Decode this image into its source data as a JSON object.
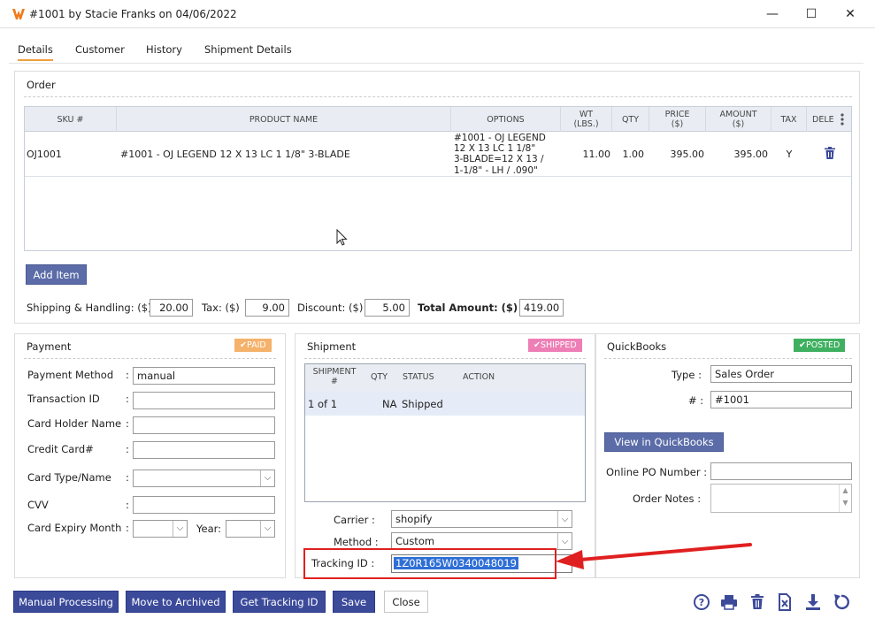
{
  "window": {
    "title": "#1001 by Stacie Franks on 04/06/2022",
    "minimize_glyph": "—",
    "maximize_glyph": "☐",
    "close_glyph": "✕"
  },
  "tabs": [
    "Details",
    "Customer",
    "History",
    "Shipment Details"
  ],
  "order": {
    "section_title": "Order",
    "columns": {
      "sku": "SKU #",
      "product": "PRODUCT NAME",
      "options": "OPTIONS",
      "wt": "WT (LBS.)",
      "qty": "QTY",
      "price": "PRICE ($)",
      "amount": "AMOUNT ($)",
      "tax": "TAX",
      "delete": "DELE"
    },
    "row": {
      "sku": "OJ1001",
      "product": "#1001 - OJ LEGEND 12 X 13 LC 1 1/8\" 3-BLADE",
      "options": [
        "#1001 - OJ LEGEND",
        "12 X 13 LC 1 1/8\"",
        "3-BLADE=12 X 13 /",
        "1-1/8\" - LH / .090\""
      ],
      "wt": "11.00",
      "qty": "1.00",
      "price": "395.00",
      "amount": "395.00",
      "tax": "Y"
    },
    "add_item_label": "Add Item",
    "shipping_label": "Shipping & Handling: ($)",
    "shipping_value": "20.00",
    "tax_label": "Tax: ($)",
    "tax_value": "9.00",
    "discount_label": "Discount: ($)",
    "discount_value": "5.00",
    "total_label": "Total Amount: ($)",
    "total_value": "419.00"
  },
  "payment": {
    "section_title": "Payment",
    "badge": "✔PAID",
    "badge_color": "#f5b26b",
    "fields": {
      "method_label": "Payment Method",
      "method_value": "manual",
      "transaction_label": "Transaction ID",
      "holder_label": "Card Holder Name",
      "card_label": "Credit Card#",
      "type_label": "Card Type/Name",
      "cvv_label": "CVV",
      "expiry_label": "Card Expiry Month",
      "year_label": "Year:"
    }
  },
  "shipment": {
    "section_title": "Shipment",
    "badge": "✔SHIPPED",
    "badge_color": "#ee7fb6",
    "columns": {
      "shipment": "SHIPMENT #",
      "qty": "QTY",
      "status": "STATUS",
      "action": "ACTION"
    },
    "row": {
      "shipment": "1 of 1",
      "qty": "NA",
      "status": "Shipped"
    },
    "carrier_label": "Carrier :",
    "carrier_value": "shopify",
    "method_label": "Method :",
    "method_value": "Custom",
    "tracking_label": "Tracking ID :",
    "tracking_value": "1Z0R165W0340048019"
  },
  "quickbooks": {
    "section_title": "QuickBooks",
    "badge": "✔POSTED",
    "badge_color": "#3fb060",
    "type_label": "Type :",
    "type_value": "Sales Order",
    "number_label": "# :",
    "number_value": "#1001",
    "view_button": "View in QuickBooks",
    "po_label": "Online PO Number :",
    "notes_label": "Order Notes :"
  },
  "footer": {
    "manual_processing": "Manual Processing",
    "move_archived": "Move to Archived",
    "get_tracking": "Get Tracking ID",
    "save": "Save",
    "close": "Close"
  },
  "colors": {
    "highlight_red": "#e02020",
    "selection_blue": "#2f6fd6",
    "button_blue": "#5b6ca8",
    "button_navy": "#3c4a9a",
    "tab_accent": "#f0a040"
  },
  "icons": [
    "app-logo-icon",
    "trash-icon",
    "kebab-icon",
    "help-icon",
    "print-icon",
    "delete-icon",
    "cancel-order-icon",
    "download-icon",
    "refresh-icon",
    "mouse-pointer-icon",
    "red-arrow-icon"
  ]
}
